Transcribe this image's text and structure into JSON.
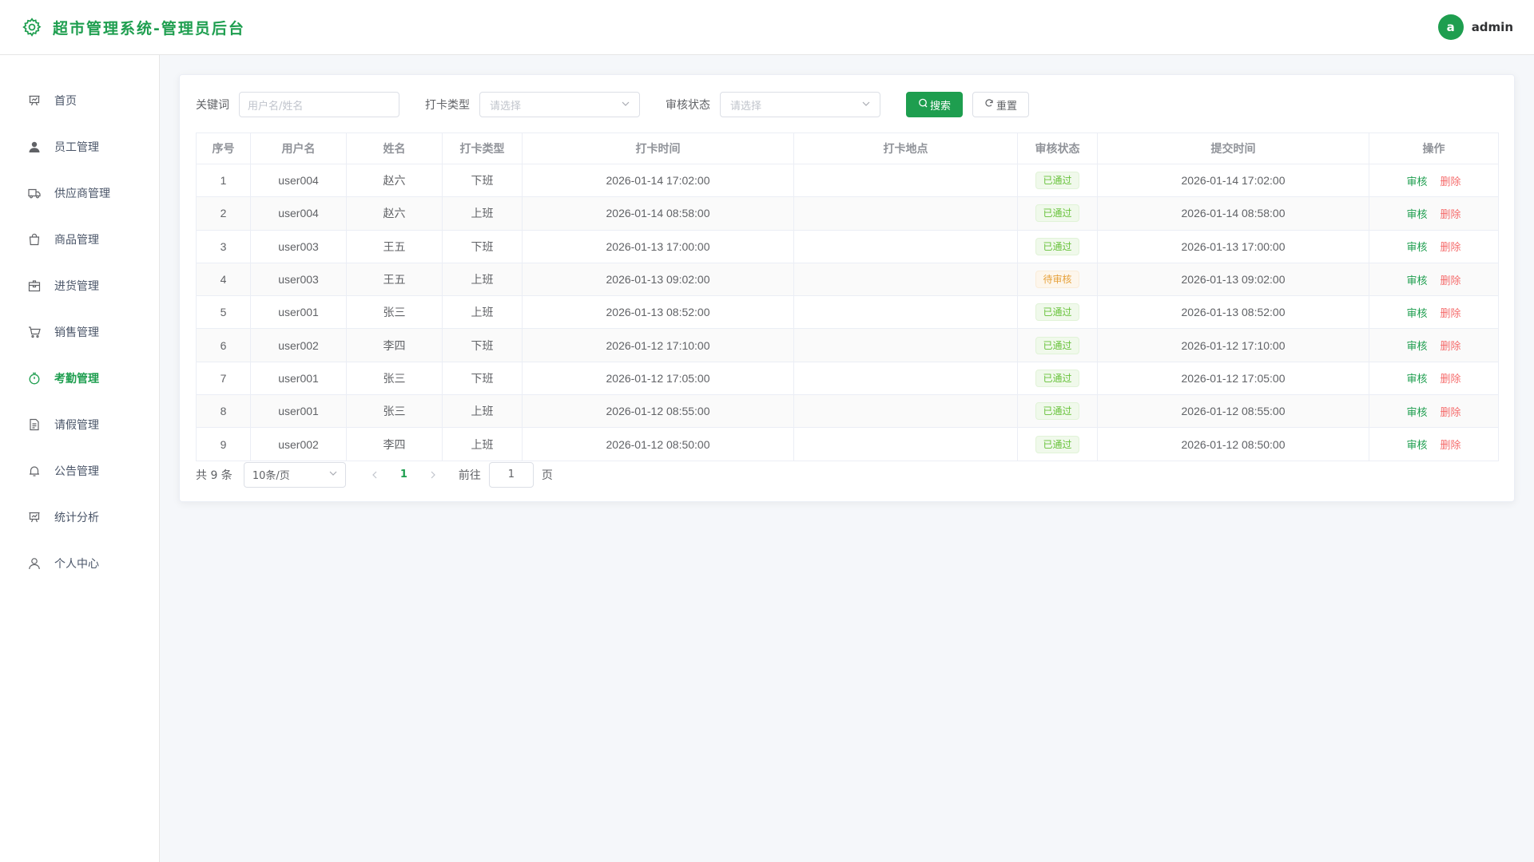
{
  "app": {
    "title": "超市管理系统-管理员后台",
    "brand_color": "#1e9e4f"
  },
  "user": {
    "avatar_letter": "a",
    "name": "admin"
  },
  "sidebar": {
    "items": [
      {
        "label": "首页",
        "icon": "presentation-icon",
        "active": false
      },
      {
        "label": "员工管理",
        "icon": "user-icon",
        "active": false
      },
      {
        "label": "供应商管理",
        "icon": "truck-icon",
        "active": false
      },
      {
        "label": "商品管理",
        "icon": "bag-icon",
        "active": false
      },
      {
        "label": "进货管理",
        "icon": "box-icon",
        "active": false
      },
      {
        "label": "销售管理",
        "icon": "cart-icon",
        "active": false
      },
      {
        "label": "考勤管理",
        "icon": "stopwatch-icon",
        "active": true
      },
      {
        "label": "请假管理",
        "icon": "document-icon",
        "active": false
      },
      {
        "label": "公告管理",
        "icon": "bell-icon",
        "active": false
      },
      {
        "label": "统计分析",
        "icon": "chart-board-icon",
        "active": false
      },
      {
        "label": "个人中心",
        "icon": "user-outline-icon",
        "active": false
      }
    ]
  },
  "filter": {
    "keyword_label": "关键词",
    "keyword_placeholder": "用户名/姓名",
    "type_label": "打卡类型",
    "type_placeholder": "请选择",
    "status_label": "审核状态",
    "status_placeholder": "请选择",
    "search_label": "搜索",
    "reset_label": "重置"
  },
  "table": {
    "headers": [
      "序号",
      "用户名",
      "姓名",
      "打卡类型",
      "打卡时间",
      "打卡地点",
      "审核状态",
      "提交时间",
      "操作"
    ],
    "audit_label": "审核",
    "delete_label": "删除",
    "rows": [
      {
        "no": "1",
        "username": "user004",
        "name": "赵六",
        "type": "下班",
        "time": "2026-01-14 17:02:00",
        "location": "",
        "status": "已通过",
        "status_kind": "ok",
        "submitted": "2026-01-14 17:02:00"
      },
      {
        "no": "2",
        "username": "user004",
        "name": "赵六",
        "type": "上班",
        "time": "2026-01-14 08:58:00",
        "location": "",
        "status": "已通过",
        "status_kind": "ok",
        "submitted": "2026-01-14 08:58:00"
      },
      {
        "no": "3",
        "username": "user003",
        "name": "王五",
        "type": "下班",
        "time": "2026-01-13 17:00:00",
        "location": "",
        "status": "已通过",
        "status_kind": "ok",
        "submitted": "2026-01-13 17:00:00"
      },
      {
        "no": "4",
        "username": "user003",
        "name": "王五",
        "type": "上班",
        "time": "2026-01-13 09:02:00",
        "location": "",
        "status": "待审核",
        "status_kind": "wait",
        "submitted": "2026-01-13 09:02:00"
      },
      {
        "no": "5",
        "username": "user001",
        "name": "张三",
        "type": "上班",
        "time": "2026-01-13 08:52:00",
        "location": "",
        "status": "已通过",
        "status_kind": "ok",
        "submitted": "2026-01-13 08:52:00"
      },
      {
        "no": "6",
        "username": "user002",
        "name": "李四",
        "type": "下班",
        "time": "2026-01-12 17:10:00",
        "location": "",
        "status": "已通过",
        "status_kind": "ok",
        "submitted": "2026-01-12 17:10:00"
      },
      {
        "no": "7",
        "username": "user001",
        "name": "张三",
        "type": "下班",
        "time": "2026-01-12 17:05:00",
        "location": "",
        "status": "已通过",
        "status_kind": "ok",
        "submitted": "2026-01-12 17:05:00"
      },
      {
        "no": "8",
        "username": "user001",
        "name": "张三",
        "type": "上班",
        "time": "2026-01-12 08:55:00",
        "location": "",
        "status": "已通过",
        "status_kind": "ok",
        "submitted": "2026-01-12 08:55:00"
      },
      {
        "no": "9",
        "username": "user002",
        "name": "李四",
        "type": "上班",
        "time": "2026-01-12 08:50:00",
        "location": "",
        "status": "已通过",
        "status_kind": "ok",
        "submitted": "2026-01-12 08:50:00"
      }
    ]
  },
  "pagination": {
    "total_text": "共 9 条",
    "page_size": "10条/页",
    "current_page": "1",
    "goto_label": "前往",
    "goto_value": "1",
    "page_suffix": "页"
  }
}
